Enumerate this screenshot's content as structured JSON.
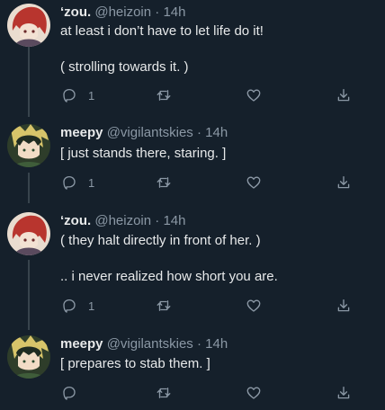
{
  "tweets": [
    {
      "name": "‘zou.",
      "handle": "@heizoin",
      "sep": "·",
      "time": "14h",
      "lines": [
        "at least i don’t have to let life do it!",
        "( strolling towards it. )"
      ],
      "reply_count": "1",
      "avatar": "red-haired-character"
    },
    {
      "name": "meepy",
      "handle": "@vigilantskies",
      "sep": "·",
      "time": "14h",
      "lines": [
        "[ just stands there, staring. ]"
      ],
      "reply_count": "1",
      "avatar": "dark-haired-character"
    },
    {
      "name": "‘zou.",
      "handle": "@heizoin",
      "sep": "·",
      "time": "14h",
      "lines": [
        "( they halt directly in front of her. )",
        ".. i never realized how short you are."
      ],
      "reply_count": "1",
      "avatar": "red-haired-character"
    },
    {
      "name": "meepy",
      "handle": "@vigilantskies",
      "sep": "·",
      "time": "14h",
      "lines": [
        "[ prepares to stab them. ]"
      ],
      "reply_count": "",
      "avatar": "dark-haired-character"
    }
  ],
  "icons": {
    "reply": "reply-icon",
    "retweet": "retweet-icon",
    "like": "heart-icon",
    "share": "share-icon"
  },
  "colors": {
    "background": "#15202b",
    "text": "#e7e9ea",
    "muted": "#8b98a5",
    "thread_line": "#38444d"
  }
}
